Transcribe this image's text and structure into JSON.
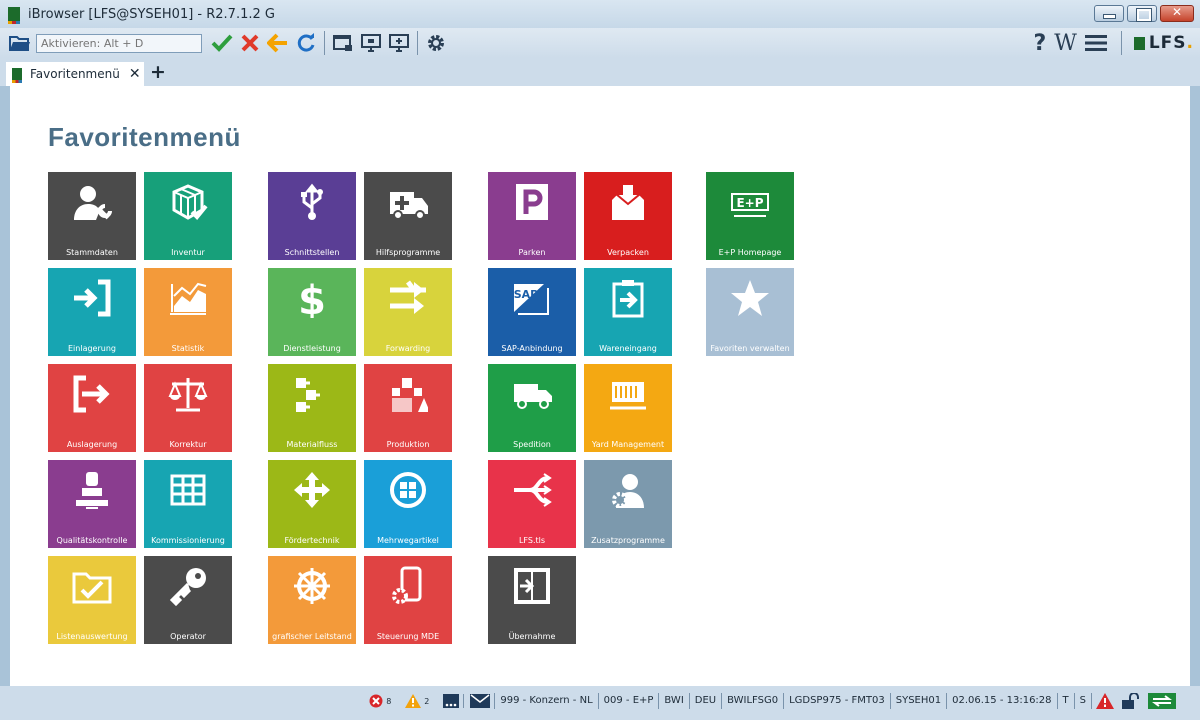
{
  "window": {
    "title": "iBrowser [LFS@SYSEH01] - R2.7.1.2 G"
  },
  "toolbar": {
    "search_placeholder": "Aktivieren: Alt + D",
    "help": "?",
    "wiki": "W",
    "logo": "LFS",
    "logo_dot": "."
  },
  "tab": {
    "label": "Favoritenmenü",
    "close": "✕",
    "add": "+"
  },
  "page": {
    "title": "Favoritenmenü"
  },
  "tiles": [
    {
      "label": "Stammdaten",
      "color": "#4b4b4b",
      "icon": "user-wrench-icon"
    },
    {
      "label": "Inventur",
      "color": "#17a07a",
      "icon": "cube-check-icon"
    },
    {
      "label": "Schnittstellen",
      "color": "#5a3e95",
      "icon": "usb-icon"
    },
    {
      "label": "Hilfsprogramme",
      "color": "#4b4b4b",
      "icon": "ambulance-icon"
    },
    {
      "label": "Parken",
      "color": "#8a3d8f",
      "icon": "parking-icon"
    },
    {
      "label": "Verpacken",
      "color": "#d81e1e",
      "icon": "box-icon"
    },
    {
      "label": "E+P Homepage",
      "color": "#1d8a3a",
      "icon": "ep-logo-icon"
    },
    {
      "label": "Einlagerung",
      "color": "#17a5b2",
      "icon": "enter-icon"
    },
    {
      "label": "Statistik",
      "color": "#f39a3a",
      "icon": "chart-icon"
    },
    {
      "label": "Dienstleistung",
      "color": "#5ab55a",
      "icon": "dollar-icon"
    },
    {
      "label": "Forwarding",
      "color": "#d8d33c",
      "icon": "arrows-right-icon"
    },
    {
      "label": "SAP-Anbindung",
      "color": "#1b5ea8",
      "icon": "sap-icon"
    },
    {
      "label": "Wareneingang",
      "color": "#17a5b2",
      "icon": "clipboard-icon"
    },
    {
      "label": "Favoriten verwalten",
      "color": "#a8bfd4",
      "icon": "star-icon"
    },
    {
      "label": "Auslagerung",
      "color": "#e04343",
      "icon": "exit-icon"
    },
    {
      "label": "Korrektur",
      "color": "#e04343",
      "icon": "scales-icon"
    },
    {
      "label": "Materialfluss",
      "color": "#9cb817",
      "icon": "flow-icon"
    },
    {
      "label": "Produktion",
      "color": "#e04343",
      "icon": "production-icon"
    },
    {
      "label": "Spedition",
      "color": "#1f9e48",
      "icon": "truck-icon"
    },
    {
      "label": "Yard Management",
      "color": "#f4a812",
      "icon": "yard-icon"
    },
    {
      "label": "Qualitätskontrolle",
      "color": "#8a3d8f",
      "icon": "stamp-icon"
    },
    {
      "label": "Kommissionierung",
      "color": "#17a5b2",
      "icon": "shelves-icon"
    },
    {
      "label": "Fördertechnik",
      "color": "#9cb817",
      "icon": "move-icon"
    },
    {
      "label": "Mehrwegartikel",
      "color": "#1a9fd8",
      "icon": "recycle-icon"
    },
    {
      "label": "LFS.tls",
      "color": "#e8334a",
      "icon": "fork-icon"
    },
    {
      "label": "Zusatzprogramme",
      "color": "#7c99ad",
      "icon": "user-gear-icon"
    },
    {
      "label": "Listenauswertung",
      "color": "#eac93c",
      "icon": "folder-check-icon"
    },
    {
      "label": "Operator",
      "color": "#4b4b4b",
      "icon": "key-icon"
    },
    {
      "label": "grafischer Leitstand",
      "color": "#f39a3a",
      "icon": "wheel-icon"
    },
    {
      "label": "Steuerung MDE",
      "color": "#e04343",
      "icon": "mobile-gear-icon"
    },
    {
      "label": "Übernahme",
      "color": "#4b4b4b",
      "icon": "transfer-icon"
    }
  ],
  "status": {
    "errors": "8",
    "warnings": "2",
    "items": [
      "999 - Konzern - NL",
      "009 - E+P",
      "BWI",
      "DEU",
      "BWILFSG0",
      "LGDSP975 - FMT03",
      "SYSEH01",
      "02.06.15 - 13:16:28",
      "T",
      "S"
    ]
  }
}
